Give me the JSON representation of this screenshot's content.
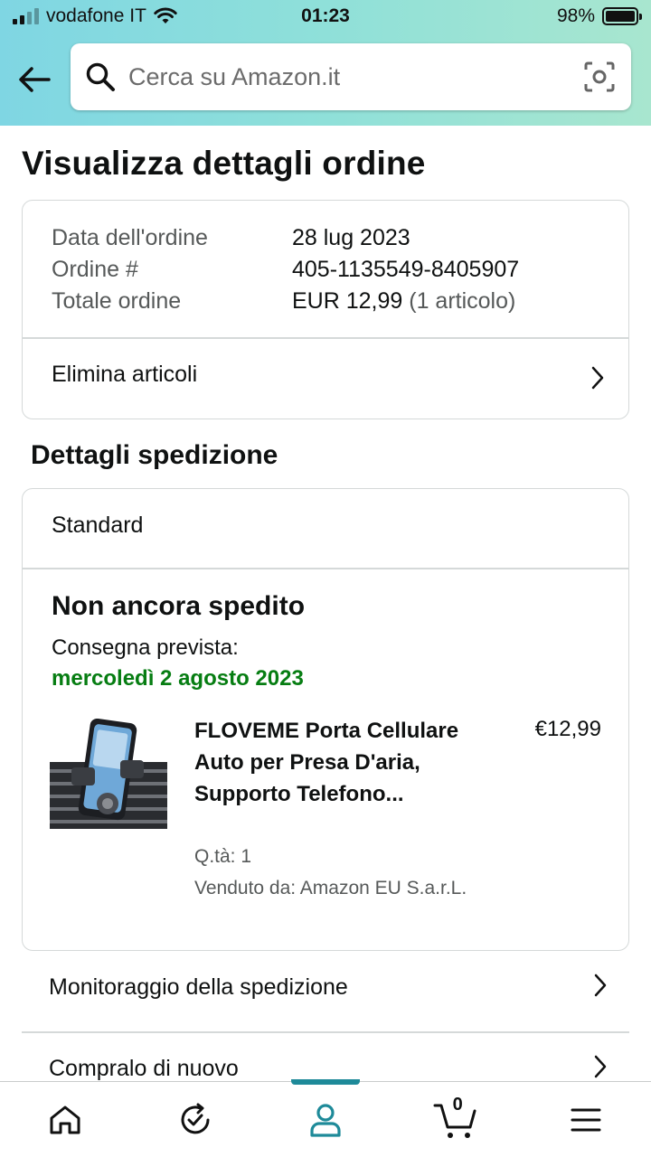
{
  "status_bar": {
    "carrier": "vodafone IT",
    "time": "01:23",
    "battery": "98%"
  },
  "search": {
    "placeholder": "Cerca su Amazon.it"
  },
  "page_title": "Visualizza dettagli ordine",
  "order_summary": {
    "date_label": "Data dell'ordine",
    "date_value": "28 lug 2023",
    "number_label": "Ordine #",
    "number_value": "405-1135549-8405907",
    "total_label": "Totale ordine",
    "total_value": "EUR 12,99",
    "total_count": "(1 articolo)",
    "delete_label": "Elimina articoli"
  },
  "shipping": {
    "section_title": "Dettagli spedizione",
    "method": "Standard",
    "status": "Non ancora spedito",
    "delivery_label": "Consegna prevista:",
    "delivery_date": "mercoledì 2 agosto 2023",
    "product": {
      "title": "FLOVEME Porta Cellulare Auto per Presa D'aria, Supporto Telefono...",
      "price": "€12,99",
      "quantity": "Q.tà: 1",
      "seller": "Venduto da: Amazon EU S.a.r.L."
    }
  },
  "links": {
    "tracking": "Monitoraggio della spedizione",
    "buy_again": "Compralo di nuovo"
  },
  "bottom_nav": {
    "cart_count": "0",
    "active": "account"
  },
  "colors": {
    "accent": "#1e8a99",
    "delivery_green": "#067d12",
    "header_gradient_start": "#7fd6e3",
    "header_gradient_end": "#a8e6cf"
  }
}
